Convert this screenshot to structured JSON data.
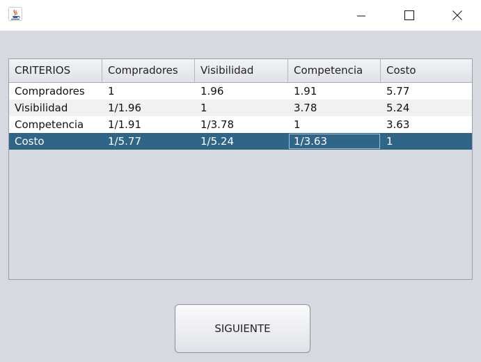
{
  "window": {
    "title": "",
    "icons": {
      "app": "java-cup-icon",
      "minimize": "minimize-icon",
      "maximize": "maximize-icon",
      "close": "close-icon"
    }
  },
  "table": {
    "columns": [
      "CRITERIOS",
      "Compradores",
      "Visibilidad",
      "Competencia",
      "Costo"
    ],
    "rows": [
      [
        "Compradores",
        "1",
        "1.96",
        "1.91",
        "5.77"
      ],
      [
        "Visibilidad",
        "1/1.96",
        "1",
        "3.78",
        "5.24"
      ],
      [
        "Competencia",
        "1/1.91",
        "1/3.78",
        "1",
        "3.63"
      ],
      [
        "Costo",
        "1/5.77",
        "1/5.24",
        "1/3.63",
        "1"
      ]
    ],
    "selected_row": 3,
    "focused_cell": [
      3,
      3
    ],
    "colors": {
      "selection": "#2f6587",
      "focus_border": "#9fc3dc"
    }
  },
  "actions": {
    "next_label": "SIGUIENTE"
  }
}
